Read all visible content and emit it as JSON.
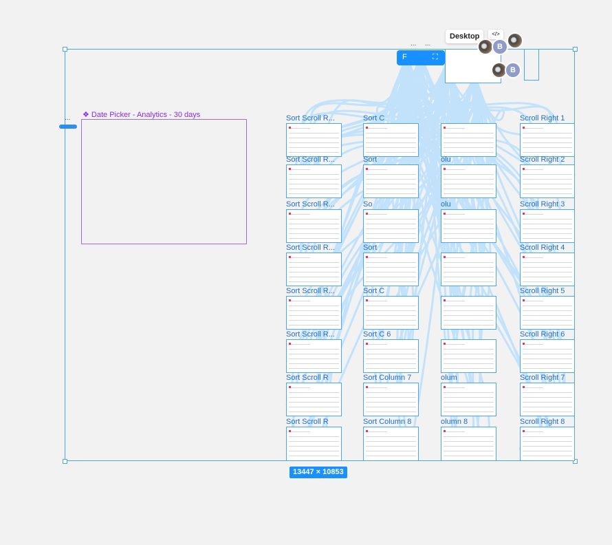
{
  "canvas": {
    "selection_size": "13447 × 10853",
    "component_title": "❖ Date Picker - Analytics - 30 days",
    "overflow_dots": "...",
    "toolbar_label": "F"
  },
  "multiplayer": {
    "tooltip": "Desktop",
    "code_icon": "</>",
    "avatar_letter": "B"
  },
  "frames": {
    "sort_scroll": [
      "Sort Scroll R...",
      "Sort Scroll R...",
      "Sort Scroll R...",
      "Sort Scroll R...",
      "Sort Scroll R...",
      "Sort Scroll R...",
      "Sort Scroll R",
      "Sort Scroll R"
    ],
    "sort_column": [
      "Sort C",
      "Sort",
      "So",
      "Sort",
      "Sort C",
      "Sort C 6",
      "Sort Column 7",
      "Sort Column 8"
    ],
    "column": [
      "",
      "olu",
      "olu",
      "",
      "",
      "",
      "olum",
      "olumn 8"
    ],
    "scroll_right": [
      "Scroll Right 1",
      "Scroll Right 2",
      "Scroll Right 3",
      "Scroll Right 4",
      "Scroll Right 5",
      "Scroll Right 6",
      "Scroll Right 7",
      "Scroll Right 8"
    ]
  },
  "colors": {
    "selection": "#4aa6ee",
    "badge": "#1890ff",
    "component": "#a46bd8",
    "connector": "#c2e2fb",
    "connector_purple": "#e3cff8"
  }
}
